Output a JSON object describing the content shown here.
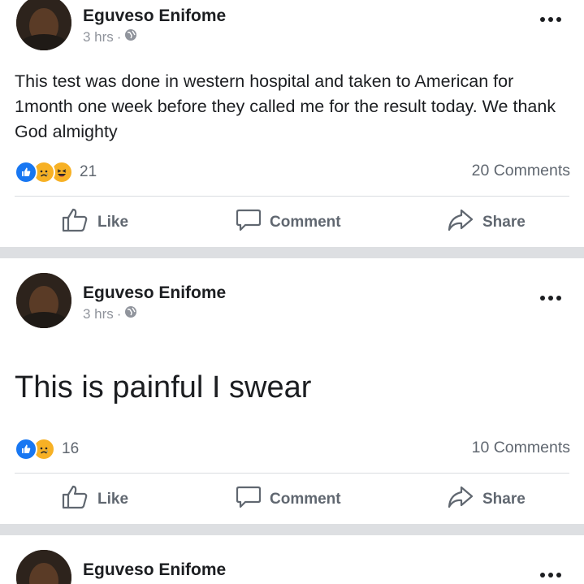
{
  "posts": [
    {
      "author": "Eguveso Enifome",
      "time": "3 hrs",
      "separator": "·",
      "text": "This test was done in western hospital and taken to American for 1month one week before they called me for the result today. We thank God almighty",
      "reaction_count": "21",
      "reactions": [
        "like-icon",
        "sad-icon",
        "haha-icon"
      ],
      "comments": "20 Comments",
      "actions": {
        "like": "Like",
        "comment": "Comment",
        "share": "Share"
      }
    },
    {
      "author": "Eguveso Enifome",
      "time": "3 hrs",
      "separator": "·",
      "text": "This is painful I swear",
      "reaction_count": "16",
      "reactions": [
        "like-icon",
        "sad-icon"
      ],
      "comments": "10 Comments",
      "actions": {
        "like": "Like",
        "comment": "Comment",
        "share": "Share"
      }
    },
    {
      "author": "Eguveso Enifome"
    }
  ],
  "colors": {
    "like_blue": "#1877f2",
    "reaction_yellow": "#f7b125",
    "separator_gray": "#dddfe2",
    "secondary_text": "#606770"
  }
}
